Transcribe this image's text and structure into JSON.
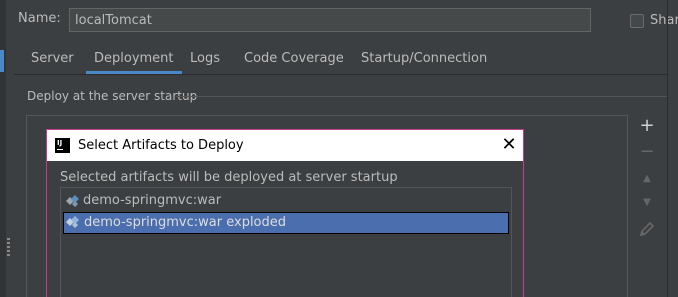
{
  "config": {
    "name_label": "Name:",
    "name_value": "localTomcat",
    "share_label": "Share"
  },
  "tabs": [
    {
      "label": "Server"
    },
    {
      "label": "Deployment"
    },
    {
      "label": "Logs"
    },
    {
      "label": "Code Coverage"
    },
    {
      "label": "Startup/Connection"
    }
  ],
  "active_tab": "Deployment",
  "deployment": {
    "section_title": "Deploy at the server startup"
  },
  "toolbar": {
    "add": "+",
    "remove": "−",
    "move_up": "▲",
    "move_down": "▼",
    "edit_icon": "pencil-icon"
  },
  "dialog": {
    "title": "Select Artifacts to Deploy",
    "app_icon_text": "IJ",
    "close": "✕",
    "description": "Selected artifacts will be deployed at server startup",
    "artifacts": [
      {
        "label": "demo-springmvc:war",
        "selected": false,
        "icon": "artifact-icon"
      },
      {
        "label": "demo-springmvc:war exploded",
        "selected": true,
        "icon": "artifact-icon"
      }
    ]
  },
  "colors": {
    "background": "#3c3f41",
    "accent": "#4a88c7",
    "selection": "#4b6eaf",
    "dialog_border": "#c53d8e"
  }
}
